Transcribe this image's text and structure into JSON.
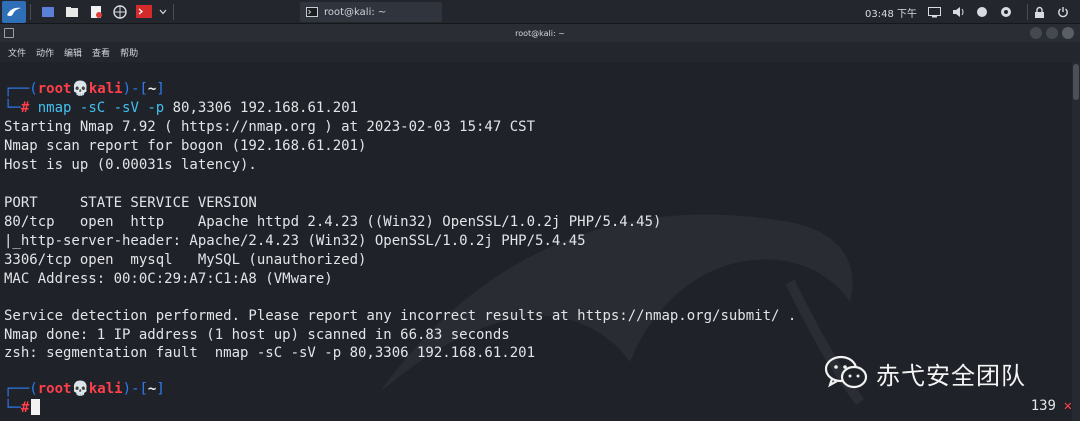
{
  "panel": {
    "window_task_label": "root@kali: ~",
    "clock": "03:48 下午"
  },
  "window": {
    "title": "root@kali: ~"
  },
  "menubar": {
    "items": [
      "文件",
      "动作",
      "编辑",
      "查看",
      "帮助"
    ]
  },
  "prompt": {
    "user": "root",
    "host": "kali",
    "dir": "~",
    "symbol": "#"
  },
  "terminal": {
    "command_name": "nmap",
    "command_flags": "-sC -sV -p",
    "command_args": "80,3306 192.168.61.201",
    "output": [
      "Starting Nmap 7.92 ( https://nmap.org ) at 2023-02-03 15:47 CST",
      "Nmap scan report for bogon (192.168.61.201)",
      "Host is up (0.00031s latency).",
      "",
      "PORT     STATE SERVICE VERSION",
      "80/tcp   open  http    Apache httpd 2.4.23 ((Win32) OpenSSL/1.0.2j PHP/5.4.45)",
      "|_http-server-header: Apache/2.4.23 (Win32) OpenSSL/1.0.2j PHP/5.4.45",
      "3306/tcp open  mysql   MySQL (unauthorized)",
      "MAC Address: 00:0C:29:A7:C1:A8 (VMware)",
      "",
      "Service detection performed. Please report any incorrect results at https://nmap.org/submit/ .",
      "Nmap done: 1 IP address (1 host up) scanned in 66.83 seconds",
      "zsh: segmentation fault  nmap -sC -sV -p 80,3306 192.168.61.201"
    ],
    "exit_code": "139",
    "exit_mark": "✕"
  },
  "watermark": {
    "text": "赤弋安全团队"
  },
  "colors": {
    "prompt_frame": "#2f7cf0",
    "prompt_user": "#ff3f4a",
    "command": "#43c0f0",
    "background": "#1f2229"
  }
}
